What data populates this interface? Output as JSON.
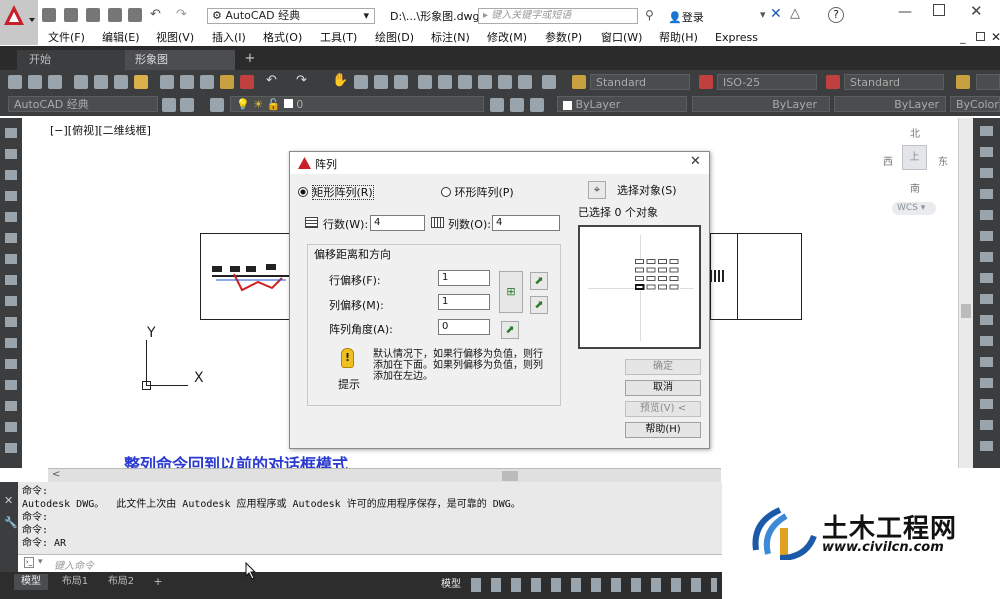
{
  "title": {
    "workspace": "AutoCAD 经典",
    "file": "D:\\...\\形象图.dwg",
    "search_placeholder": "键入关键字或短语",
    "login": "登录"
  },
  "menu": [
    "文件(F)",
    "编辑(E)",
    "视图(V)",
    "插入(I)",
    "格式(O)",
    "工具(T)",
    "绘图(D)",
    "标注(N)",
    "修改(M)",
    "参数(P)",
    "窗口(W)",
    "帮助(H)",
    "Express"
  ],
  "tabs": {
    "start": "开始",
    "drawing": "形象图",
    "add": "+"
  },
  "ribbon": {
    "text_style": "Standard",
    "dim_style": "ISO-25",
    "table_style": "Standard",
    "workspace": "AutoCAD 经典",
    "layer": "0",
    "color": "ByLayer",
    "linetype": "ByLayer",
    "lineweight": "ByLayer",
    "plotstyle": "ByColor"
  },
  "viewport": {
    "label": "[−][俯视][二维线框]",
    "axis_y": "Y",
    "axis_x": "X",
    "compass": {
      "n": "北",
      "s": "南",
      "e": "东",
      "w": "西",
      "top": "上"
    },
    "wcs": "WCS"
  },
  "annotation": "整列命令回到以前的对话框模式",
  "dialog": {
    "title": "阵列",
    "rect_radio": "矩形阵列(R)",
    "polar_radio": "环形阵列(P)",
    "select_objects": "选择对象(S)",
    "selected_count": "已选择 0 个对象",
    "rows_label": "行数(W):",
    "rows_value": "4",
    "cols_label": "列数(O):",
    "cols_value": "4",
    "group_title": "偏移距离和方向",
    "row_offset_label": "行偏移(F):",
    "row_offset_value": "1",
    "col_offset_label": "列偏移(M):",
    "col_offset_value": "1",
    "angle_label": "阵列角度(A):",
    "angle_value": "0",
    "tip_text": "默认情况下，如果行偏移为负值，则行添加在下面。如果列偏移为负值，则列添加在左边。",
    "tip_label": "提示",
    "ok": "确定",
    "cancel": "取消",
    "preview": "预览(V)  <",
    "help": "帮助(H)"
  },
  "command": {
    "lines": [
      "命令:",
      "Autodesk DWG。  此文件上次由 Autodesk 应用程序或 Autodesk 许可的应用程序保存，是可靠的 DWG。",
      "命令:",
      "命令:",
      "命令: AR"
    ],
    "placeholder": "键入命令"
  },
  "status": {
    "model_tab": "模型",
    "layout1": "布局1",
    "layout2": "布局2",
    "add": "+",
    "model_btn": "模型"
  },
  "logo": {
    "name": "土木工程网",
    "url": "www.civilcn.com"
  },
  "colors": {
    "accent_red": "#c8202a",
    "logo_blue": "#1a5aa8",
    "annotation_blue": "#2a3ad0"
  }
}
